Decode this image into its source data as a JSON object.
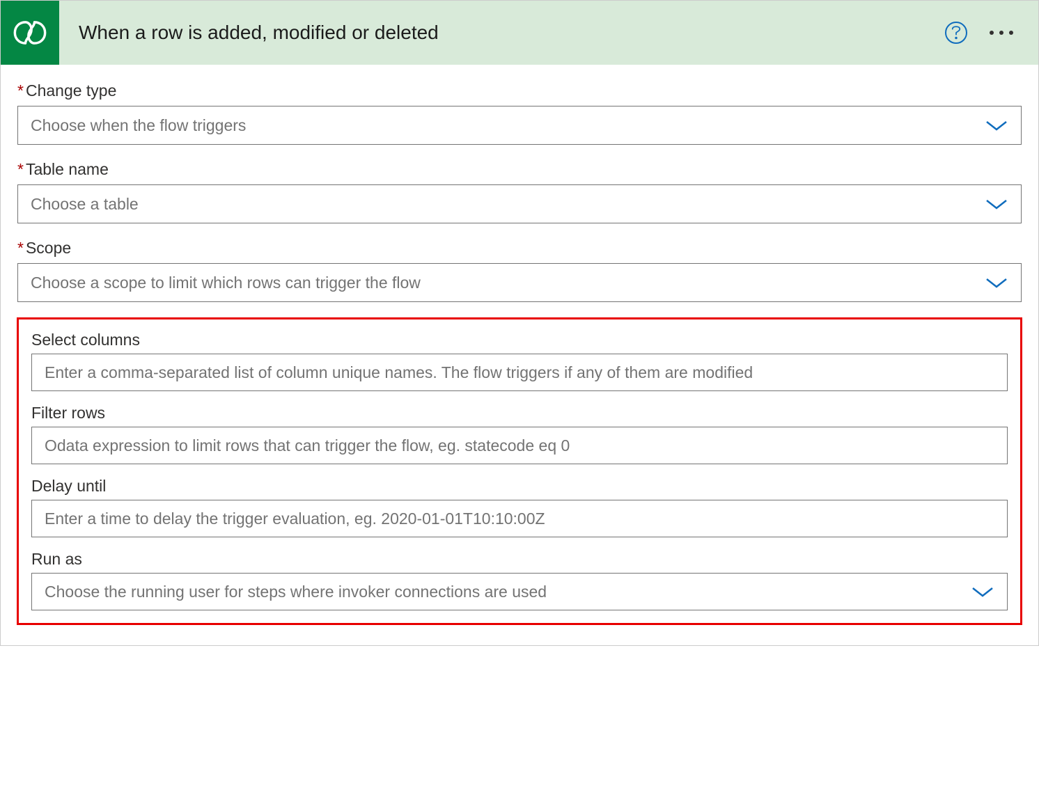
{
  "header": {
    "title": "When a row is added, modified or deleted",
    "icon_name": "dataverse-icon"
  },
  "fields": {
    "change_type": {
      "label": "Change type",
      "required": true,
      "placeholder": "Choose when the flow triggers",
      "type": "select"
    },
    "table_name": {
      "label": "Table name",
      "required": true,
      "placeholder": "Choose a table",
      "type": "select"
    },
    "scope": {
      "label": "Scope",
      "required": true,
      "placeholder": "Choose a scope to limit which rows can trigger the flow",
      "type": "select"
    },
    "select_columns": {
      "label": "Select columns",
      "required": false,
      "placeholder": "Enter a comma-separated list of column unique names. The flow triggers if any of them are modified",
      "type": "text"
    },
    "filter_rows": {
      "label": "Filter rows",
      "required": false,
      "placeholder": "Odata expression to limit rows that can trigger the flow, eg. statecode eq 0",
      "type": "text"
    },
    "delay_until": {
      "label": "Delay until",
      "required": false,
      "placeholder": "Enter a time to delay the trigger evaluation, eg. 2020-01-01T10:10:00Z",
      "type": "text"
    },
    "run_as": {
      "label": "Run as",
      "required": false,
      "placeholder": "Choose the running user for steps where invoker connections are used",
      "type": "select"
    }
  },
  "required_marker": "*"
}
